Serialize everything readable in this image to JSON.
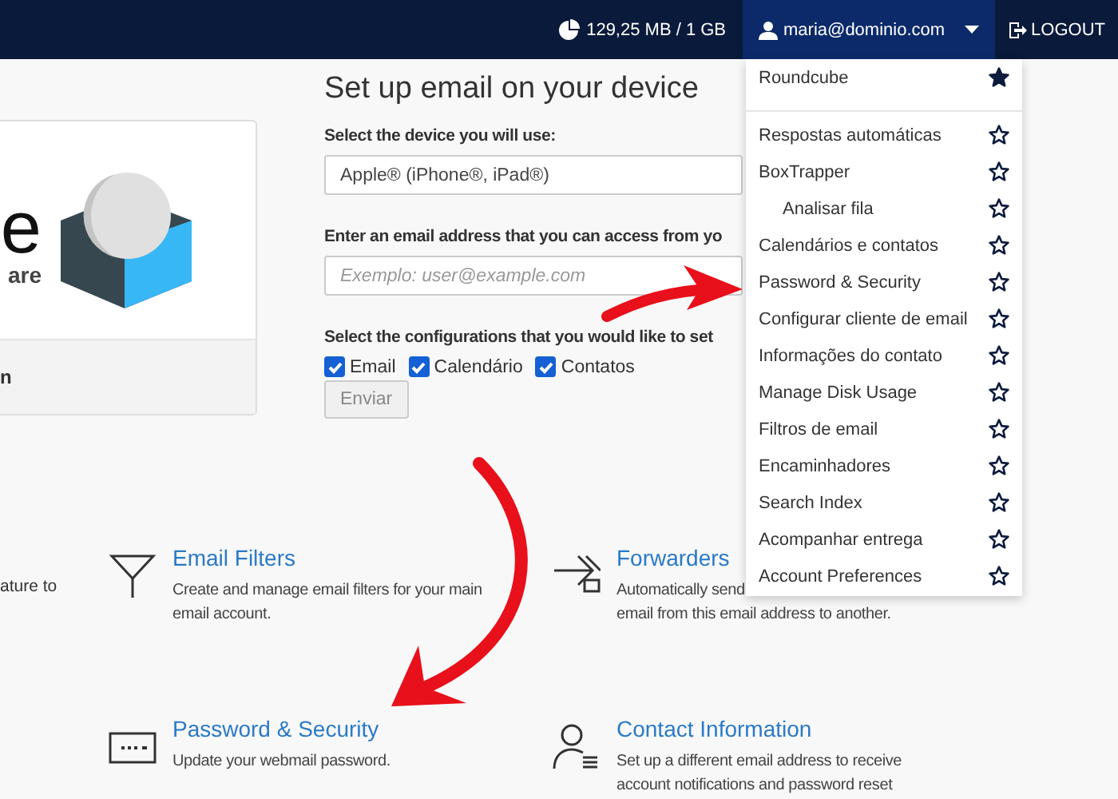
{
  "header": {
    "quota": "129,25 MB / 1 GB",
    "user": "maria@dominio.com",
    "logout": "LOGOUT"
  },
  "app_card": {
    "logo_letter": "e",
    "logo_sub": "are",
    "footer": "n"
  },
  "setup": {
    "title": "Set up email on your device",
    "device_label": "Select the device you will use:",
    "device_value": "Apple® (iPhone®, iPad®)",
    "email_label": "Enter an email address that you can access from yo",
    "email_placeholder": "Exemplo: user@example.com",
    "config_label": "Select the configurations that you would like to set",
    "options": [
      {
        "label": "Email",
        "checked": true
      },
      {
        "label": "Calendário",
        "checked": true
      },
      {
        "label": "Contatos",
        "checked": true
      }
    ],
    "submit": "Enviar"
  },
  "features_left_fragment": "ature to",
  "features": [
    {
      "kind": "filter",
      "title": "Email Filters",
      "lines": [
        "Create and manage email filters for your main",
        "email account."
      ]
    },
    {
      "kind": "forward",
      "title": "Forwarders",
      "lines": [
        "Automatically send",
        "email from this email address to another."
      ]
    },
    {
      "kind": "password",
      "title": "Password & Security",
      "lines": [
        "Update your webmail password."
      ]
    },
    {
      "kind": "contact",
      "title": "Contact Information",
      "lines": [
        "Set up a different email address to receive",
        "account notifications and password reset"
      ]
    }
  ],
  "menu": {
    "sections": [
      [
        {
          "label": "Roundcube",
          "favorite": true
        }
      ],
      [
        {
          "label": "Respostas automáticas",
          "favorite": false
        },
        {
          "label": "BoxTrapper",
          "favorite": false,
          "children": [
            {
              "label": "Analisar fila",
              "favorite": false
            }
          ]
        },
        {
          "label": "Calendários e contatos",
          "favorite": false
        },
        {
          "label": "Password & Security",
          "favorite": false
        },
        {
          "label": "Configurar cliente de email",
          "favorite": false
        },
        {
          "label": "Informações do contato",
          "favorite": false
        },
        {
          "label": "Manage Disk Usage",
          "favorite": false
        },
        {
          "label": "Filtros de email",
          "favorite": false
        },
        {
          "label": "Encaminhadores",
          "favorite": false
        },
        {
          "label": "Search Index",
          "favorite": false
        },
        {
          "label": "Acompanhar entrega",
          "favorite": false
        },
        {
          "label": "Account Preferences",
          "favorite": false
        }
      ]
    ]
  }
}
